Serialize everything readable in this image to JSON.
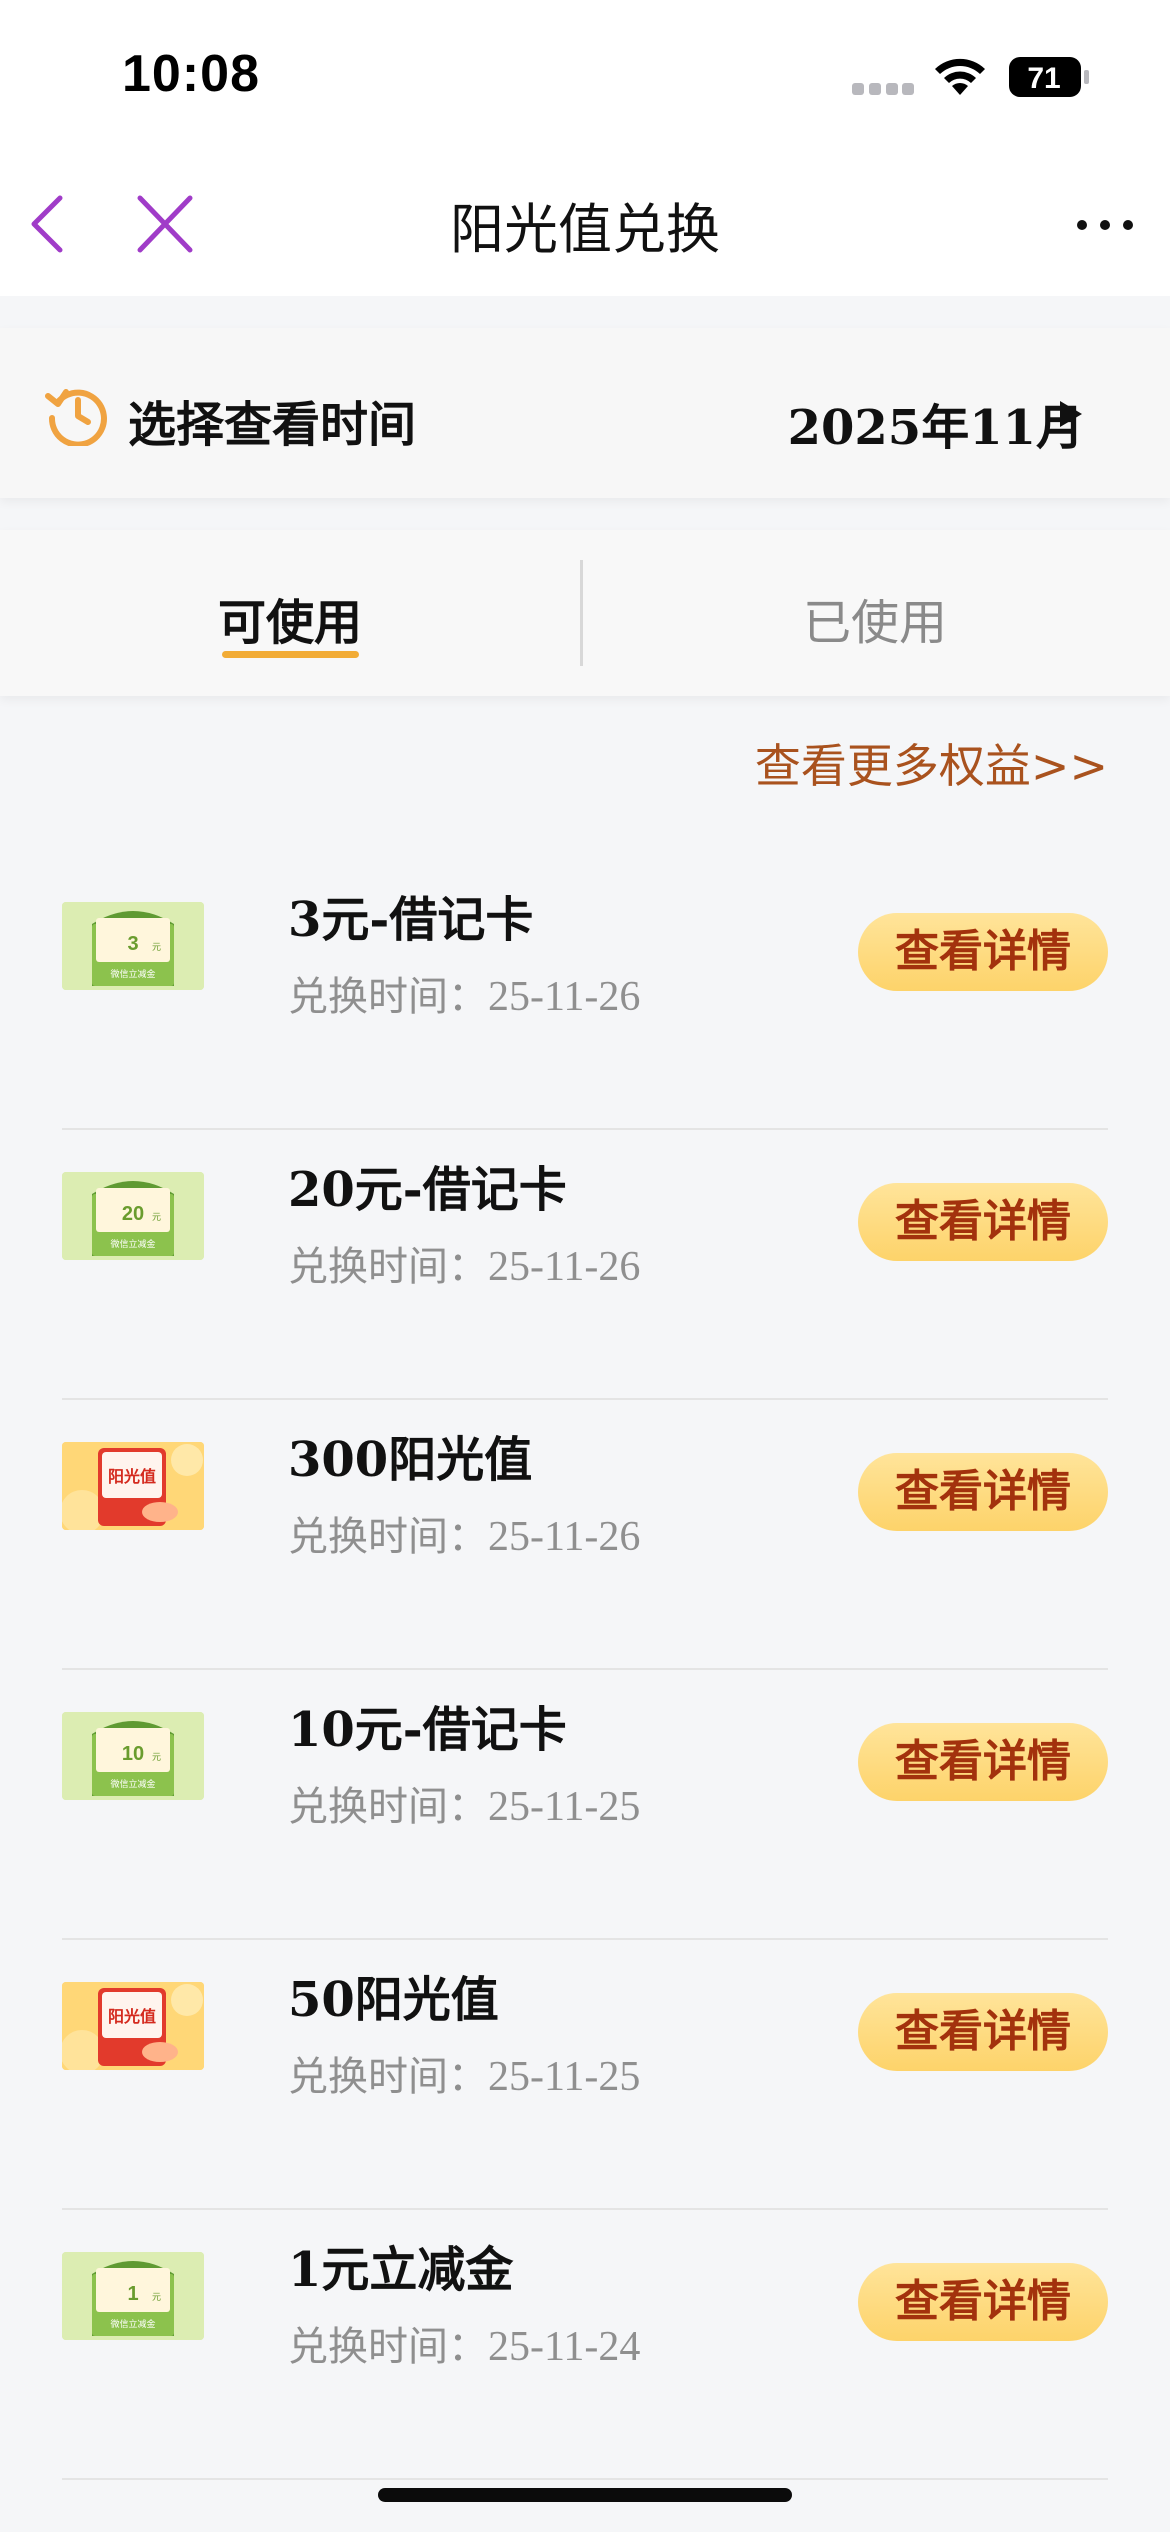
{
  "status_bar": {
    "time": "10:08",
    "battery": "71"
  },
  "nav": {
    "title": "阳光值兑换"
  },
  "time_selector": {
    "label": "选择查看时间",
    "value": "2025年11月"
  },
  "tabs": [
    {
      "label": "可使用",
      "active": true
    },
    {
      "label": "已使用",
      "active": false
    }
  ],
  "more_link": "查看更多权益>>",
  "items": [
    {
      "title": "3元-借记卡",
      "date_label": "兑换时间：",
      "date": "25-11-26",
      "button": "查看详情",
      "thumb": {
        "type": "green",
        "amount": "3",
        "unit": "元",
        "caption": "微信立减金"
      }
    },
    {
      "title": "20元-借记卡",
      "date_label": "兑换时间：",
      "date": "25-11-26",
      "button": "查看详情",
      "thumb": {
        "type": "green",
        "amount": "20",
        "unit": "元",
        "caption": "微信立减金"
      }
    },
    {
      "title": "300阳光值",
      "date_label": "兑换时间：",
      "date": "25-11-26",
      "button": "查看详情",
      "thumb": {
        "type": "orange",
        "amount": "阳光值",
        "unit": "",
        "caption": ""
      }
    },
    {
      "title": "10元-借记卡",
      "date_label": "兑换时间：",
      "date": "25-11-25",
      "button": "查看详情",
      "thumb": {
        "type": "green",
        "amount": "10",
        "unit": "元",
        "caption": "微信立减金"
      }
    },
    {
      "title": "50阳光值",
      "date_label": "兑换时间：",
      "date": "25-11-25",
      "button": "查看详情",
      "thumb": {
        "type": "orange",
        "amount": "阳光值",
        "unit": "",
        "caption": ""
      }
    },
    {
      "title": "1元立减金",
      "date_label": "兑换时间：",
      "date": "25-11-24",
      "button": "查看详情",
      "thumb": {
        "type": "green",
        "amount": "1",
        "unit": "元",
        "caption": "微信立减金"
      }
    }
  ],
  "colors": {
    "accent_purple": "#a03cc8",
    "button_text": "#a3320d",
    "link": "#a9521e",
    "tab_underline": "#f2ac36",
    "clock_icon": "#f0a341"
  },
  "icons": [
    "back-icon",
    "close-icon",
    "more-icon",
    "clock-history-icon",
    "play-arrow-icon",
    "wifi-icon",
    "battery-icon",
    "signal-icon"
  ]
}
